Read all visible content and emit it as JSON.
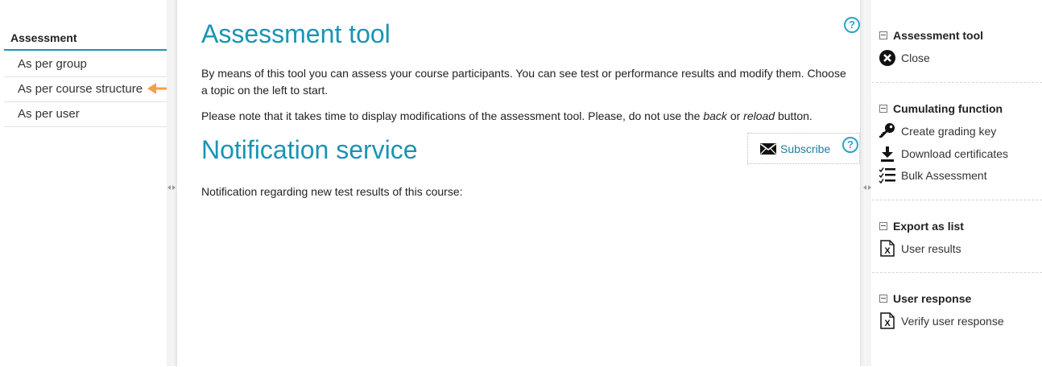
{
  "left_nav": {
    "header": "Assessment",
    "items": [
      {
        "label": "As per group"
      },
      {
        "label": "As per course structure"
      },
      {
        "label": "As per user"
      }
    ]
  },
  "main": {
    "title": "Assessment tool",
    "help_symbol": "?",
    "intro": "By means of this tool you can assess your course participants. You can see test or performance results and modify them. Choose a topic on the left to start.",
    "note": {
      "before": "Please note that it takes time to display modifications of the assessment tool. Please, do not use the ",
      "back": "back",
      "or": " or ",
      "reload": "reload",
      "after": " button."
    },
    "notification": {
      "title": "Notification service",
      "subscribe_label": "Subscribe",
      "text": "Notification regarding new test results of this course:"
    }
  },
  "toolbox": {
    "sections": [
      {
        "title": "Assessment tool",
        "items": [
          {
            "label": "Close",
            "icon": "close-icon"
          }
        ]
      },
      {
        "title": "Cumulating function",
        "items": [
          {
            "label": "Create grading key",
            "icon": "key-icon"
          },
          {
            "label": "Download certificates",
            "icon": "download-icon"
          },
          {
            "label": "Bulk Assessment",
            "icon": "checklist-icon"
          }
        ]
      },
      {
        "title": "Export as list",
        "items": [
          {
            "label": "User results",
            "icon": "excel-file-icon"
          }
        ]
      },
      {
        "title": "User response",
        "items": [
          {
            "label": "Verify user response",
            "icon": "excel-file-icon"
          }
        ]
      }
    ]
  },
  "colors": {
    "accent": "#1a94b4",
    "annotation_arrow": "#f0a050",
    "link": "#1a7fa0"
  }
}
